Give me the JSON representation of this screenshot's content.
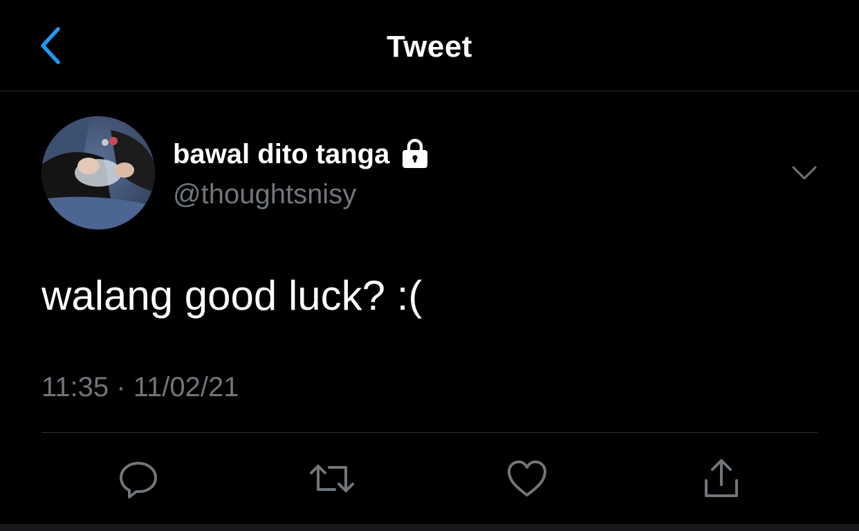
{
  "nav": {
    "title": "Tweet",
    "back_icon": "chevron-left-icon",
    "accent_color": "#1d9bf0"
  },
  "tweet": {
    "author_name": "bawal dito tanga",
    "author_handle": "@thoughtsnisy",
    "protected_icon": "lock-icon",
    "more_icon": "chevron-down-icon",
    "text": "walang good luck? :(",
    "time": "11:35",
    "separator": "·",
    "date": "11/02/21"
  },
  "actions": [
    {
      "name": "reply",
      "icon": "reply-icon"
    },
    {
      "name": "retweet",
      "icon": "retweet-icon"
    },
    {
      "name": "like",
      "icon": "heart-icon"
    },
    {
      "name": "share",
      "icon": "share-icon"
    }
  ],
  "colors": {
    "background": "#000000",
    "text_primary": "#ffffff",
    "text_secondary": "#71767b",
    "divider": "#2f3336"
  }
}
